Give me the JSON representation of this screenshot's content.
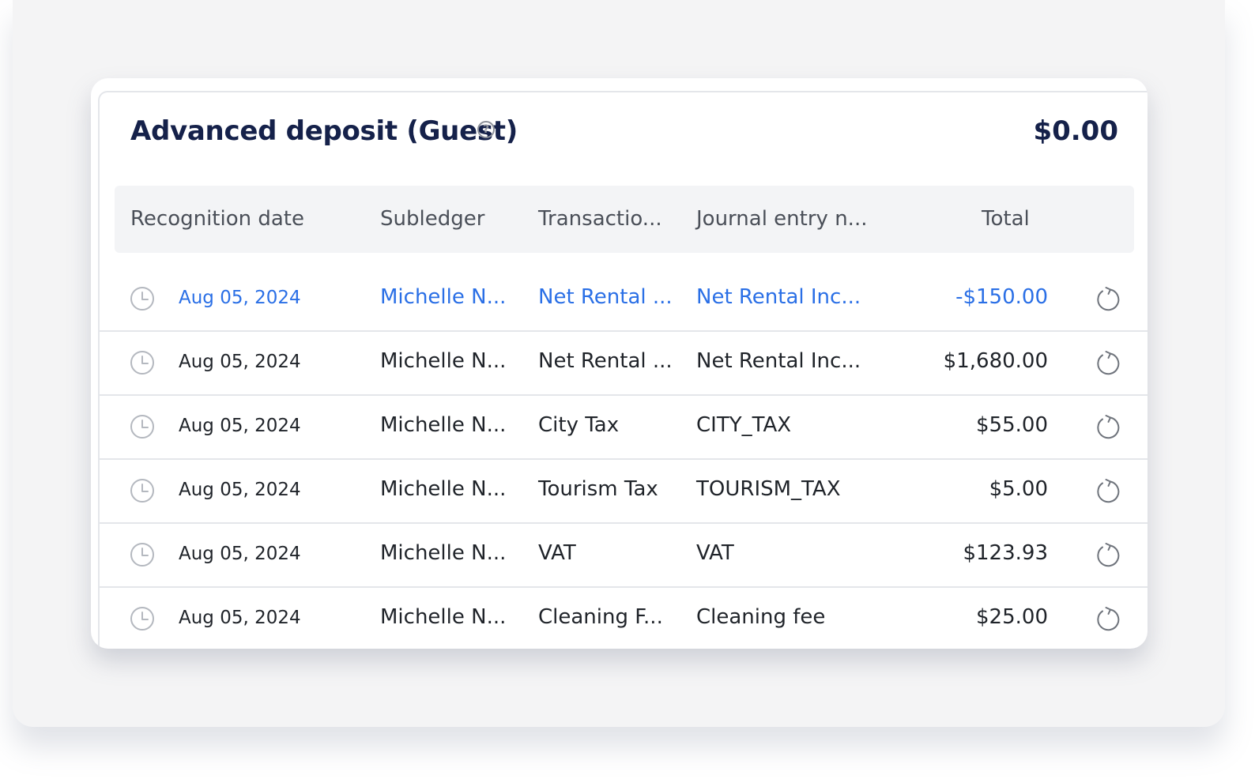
{
  "card": {
    "title": "Advanced deposit (Guest)",
    "help_icon": "question-circle-icon",
    "help_glyph": "?",
    "total": "$0.00"
  },
  "table": {
    "columns": [
      "Recognition date",
      "Subledger",
      "Transactio...",
      "Journal entry n...",
      "Total"
    ],
    "rows": [
      {
        "date": "Aug 05, 2024",
        "subledger": "Michelle N...",
        "transaction": "Net Rental ...",
        "journal": "Net Rental Inc...",
        "total": "-$150.00",
        "highlight": true
      },
      {
        "date": "Aug 05, 2024",
        "subledger": "Michelle N...",
        "transaction": "Net Rental ...",
        "journal": "Net Rental Inc...",
        "total": "$1,680.00",
        "highlight": false
      },
      {
        "date": "Aug 05, 2024",
        "subledger": "Michelle N...",
        "transaction": "City Tax",
        "journal": "CITY_TAX",
        "total": "$55.00",
        "highlight": false
      },
      {
        "date": "Aug 05, 2024",
        "subledger": "Michelle N...",
        "transaction": "Tourism Tax",
        "journal": "TOURISM_TAX",
        "total": "$5.00",
        "highlight": false
      },
      {
        "date": "Aug 05, 2024",
        "subledger": "Michelle N...",
        "transaction": "VAT",
        "journal": "VAT",
        "total": "$123.93",
        "highlight": false
      },
      {
        "date": "Aug 05, 2024",
        "subledger": "Michelle N...",
        "transaction": "Cleaning F...",
        "journal": "Cleaning fee",
        "total": "$25.00",
        "highlight": false
      }
    ],
    "row_icons": {
      "leading": "clock-icon",
      "trailing": "refresh-icon"
    }
  },
  "colors": {
    "title": "#15214a",
    "highlight": "#2a6fe6",
    "text": "#1f2329",
    "header_bg": "#f3f4f6",
    "icon": "#a9adb5"
  }
}
